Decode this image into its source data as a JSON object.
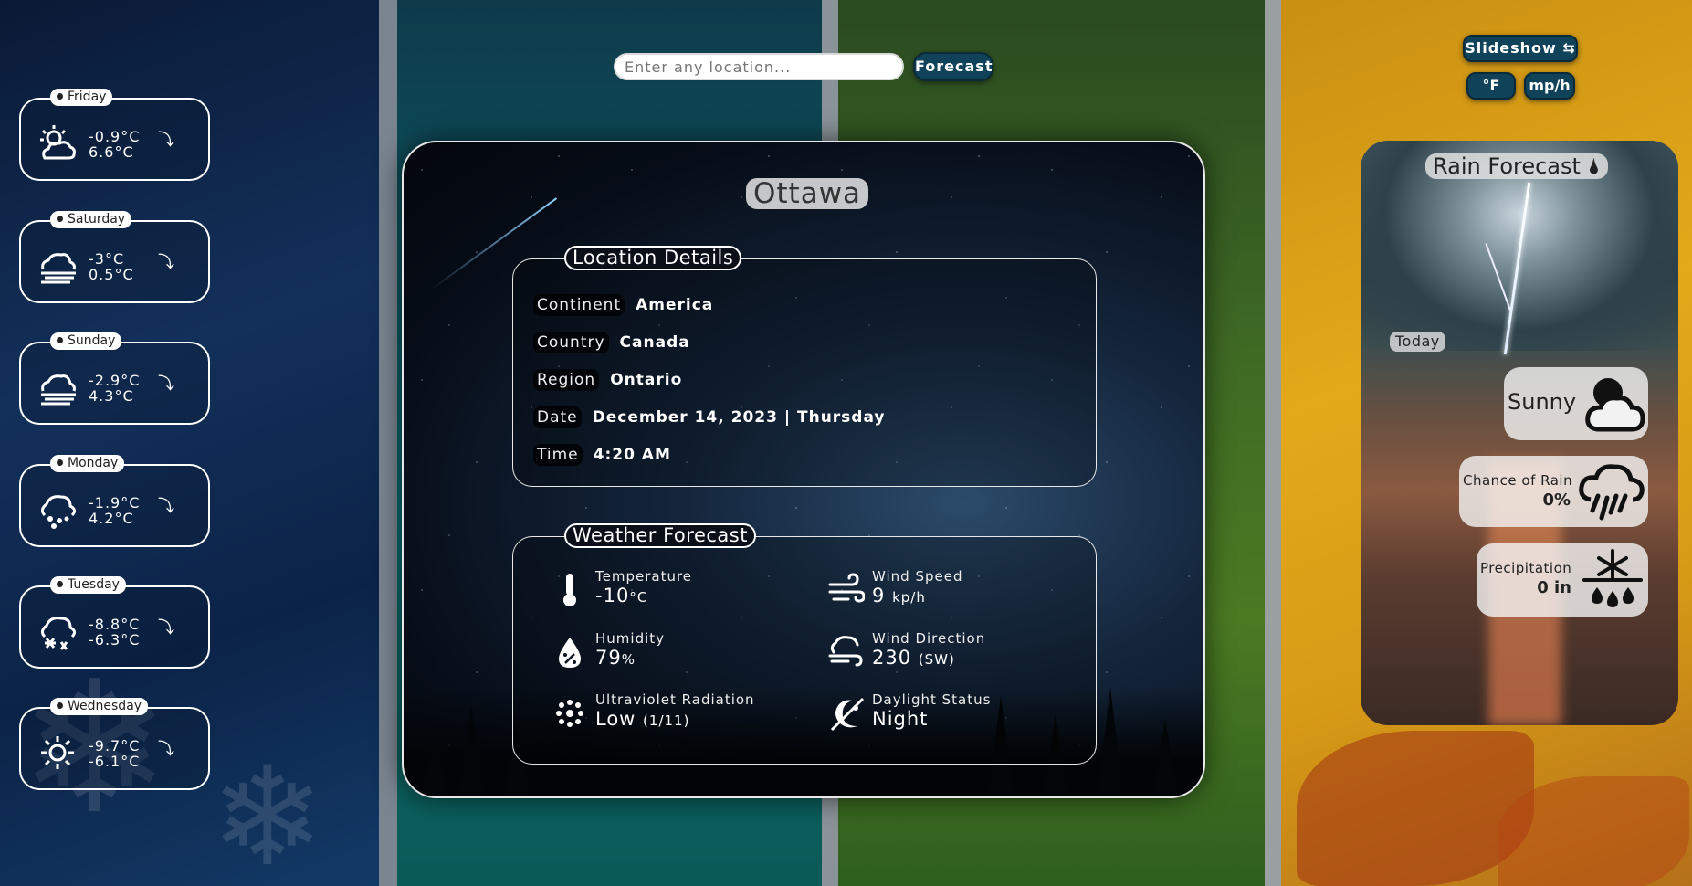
{
  "search": {
    "placeholder": "Enter any location..."
  },
  "toolbar": {
    "forecast_label": "Forecast",
    "slideshow_label": "Slideshow ⇆",
    "unit_temp_label": "°F",
    "unit_speed_label": "mp/h"
  },
  "daily": [
    {
      "day": "Friday",
      "min": "-0.9°C",
      "max": "6.6°C",
      "icon": "sun-cloud-icon"
    },
    {
      "day": "Saturday",
      "min": "-3°C",
      "max": "0.5°C",
      "icon": "fog-icon"
    },
    {
      "day": "Sunday",
      "min": "-2.9°C",
      "max": "4.3°C",
      "icon": "fog-icon"
    },
    {
      "day": "Monday",
      "min": "-1.9°C",
      "max": "4.2°C",
      "icon": "cloud-drizzle-icon"
    },
    {
      "day": "Tuesday",
      "min": "-8.8°C",
      "max": "-6.3°C",
      "icon": "cloud-snow-icon"
    },
    {
      "day": "Wednesday",
      "min": "-9.7°C",
      "max": "-6.1°C",
      "icon": "sun-icon"
    }
  ],
  "main": {
    "city": "Ottawa",
    "location_title": "Location Details",
    "location": [
      {
        "key": "Continent",
        "value": "America"
      },
      {
        "key": "Country",
        "value": "Canada"
      },
      {
        "key": "Region",
        "value": "Ontario"
      },
      {
        "key": "Date",
        "value": "December 14, 2023 | Thursday"
      },
      {
        "key": "Time",
        "value": "4:20 AM"
      }
    ],
    "weather_title": "Weather Forecast",
    "weather": {
      "temperature": {
        "label": "Temperature",
        "value": "-10",
        "unit": "°C"
      },
      "wind_speed": {
        "label": "Wind Speed",
        "value": "9",
        "unit": "kp/h"
      },
      "humidity": {
        "label": "Humidity",
        "value": "79",
        "unit": "%"
      },
      "wind_direction": {
        "label": "Wind Direction",
        "value": "230",
        "unit": "(SW)"
      },
      "uv": {
        "label": "Ultraviolet Radiation",
        "value": "Low",
        "unit": "(1/11)"
      },
      "daylight": {
        "label": "Daylight Status",
        "value": "Night"
      }
    }
  },
  "rain": {
    "title": "Rain Forecast 🌢",
    "today_label": "Today",
    "condition": "Sunny",
    "chance_label": "Chance of Rain",
    "chance_value": "0%",
    "precip_label": "Precipitation",
    "precip_value": "0 in"
  },
  "colors": {
    "button_bg": "#10435a",
    "panel_border": "#e8e8e8"
  }
}
